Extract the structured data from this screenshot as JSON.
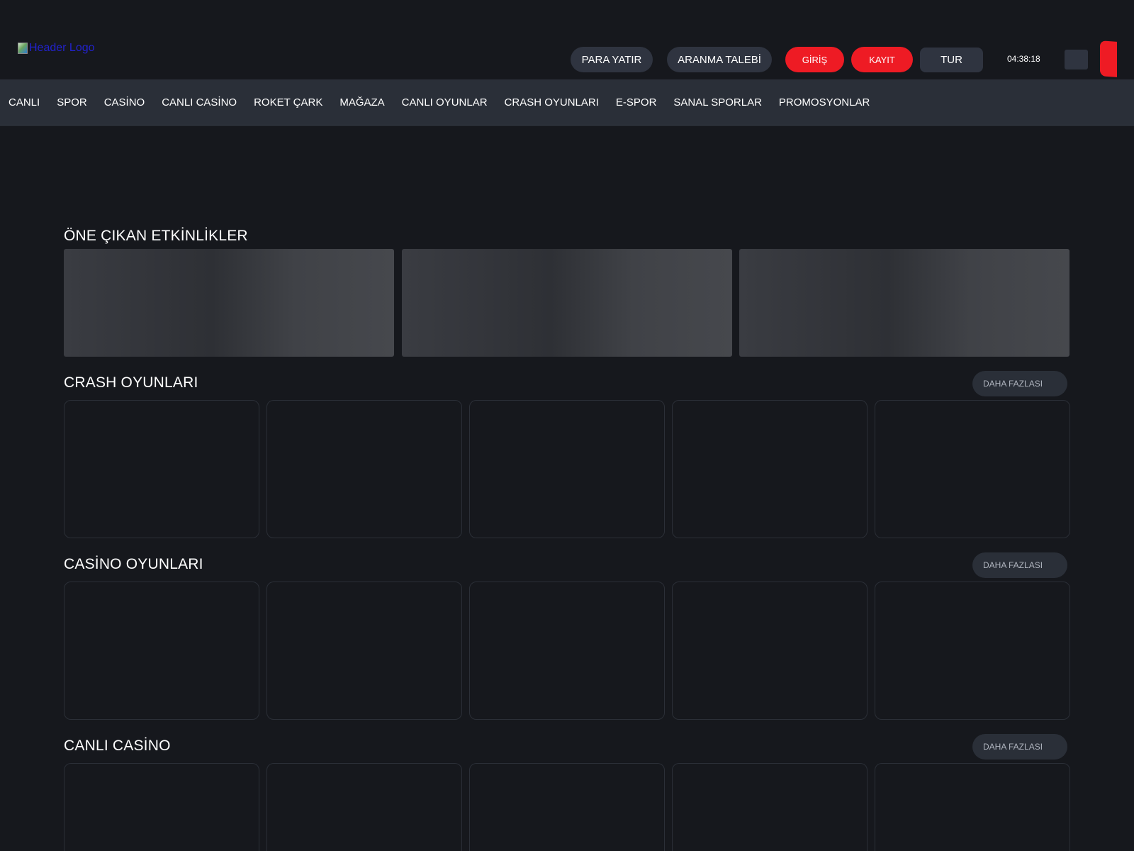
{
  "header": {
    "logo_alt": "Header Logo",
    "buttons": {
      "deposit": "PARA YATIR",
      "callback": "ARANMA TALEBİ",
      "login": "GİRİŞ",
      "register": "KAYIT",
      "language": "TUR"
    },
    "clock": "04:38:18"
  },
  "nav": {
    "items": [
      {
        "label": "CANLI"
      },
      {
        "label": "SPOR"
      },
      {
        "label": "CASİNO"
      },
      {
        "label": "CANLI CASİNO"
      },
      {
        "label": "ROKET ÇARK"
      },
      {
        "label": "MAĞAZA"
      },
      {
        "label": "CANLI OYUNLAR"
      },
      {
        "label": "CRASH OYUNLARI"
      },
      {
        "label": "E-SPOR"
      },
      {
        "label": "SANAL SPORLAR"
      },
      {
        "label": "PROMOSYONLAR"
      }
    ]
  },
  "sections": {
    "featured": {
      "title": "ÖNE ÇIKAN ETKİNLİKLER"
    },
    "crash": {
      "title": "CRASH OYUNLARI",
      "more": "DAHA FAZLASI"
    },
    "casino": {
      "title": "CASİNO OYUNLARI",
      "more": "DAHA FAZLASI"
    },
    "live_casino": {
      "title": "CANLI CASİNO",
      "more": "DAHA FAZLASI"
    }
  },
  "colors": {
    "background": "#16181d",
    "nav_background": "#2a2f38",
    "button_dark": "#2f3440",
    "accent_red": "#ee1b24"
  }
}
